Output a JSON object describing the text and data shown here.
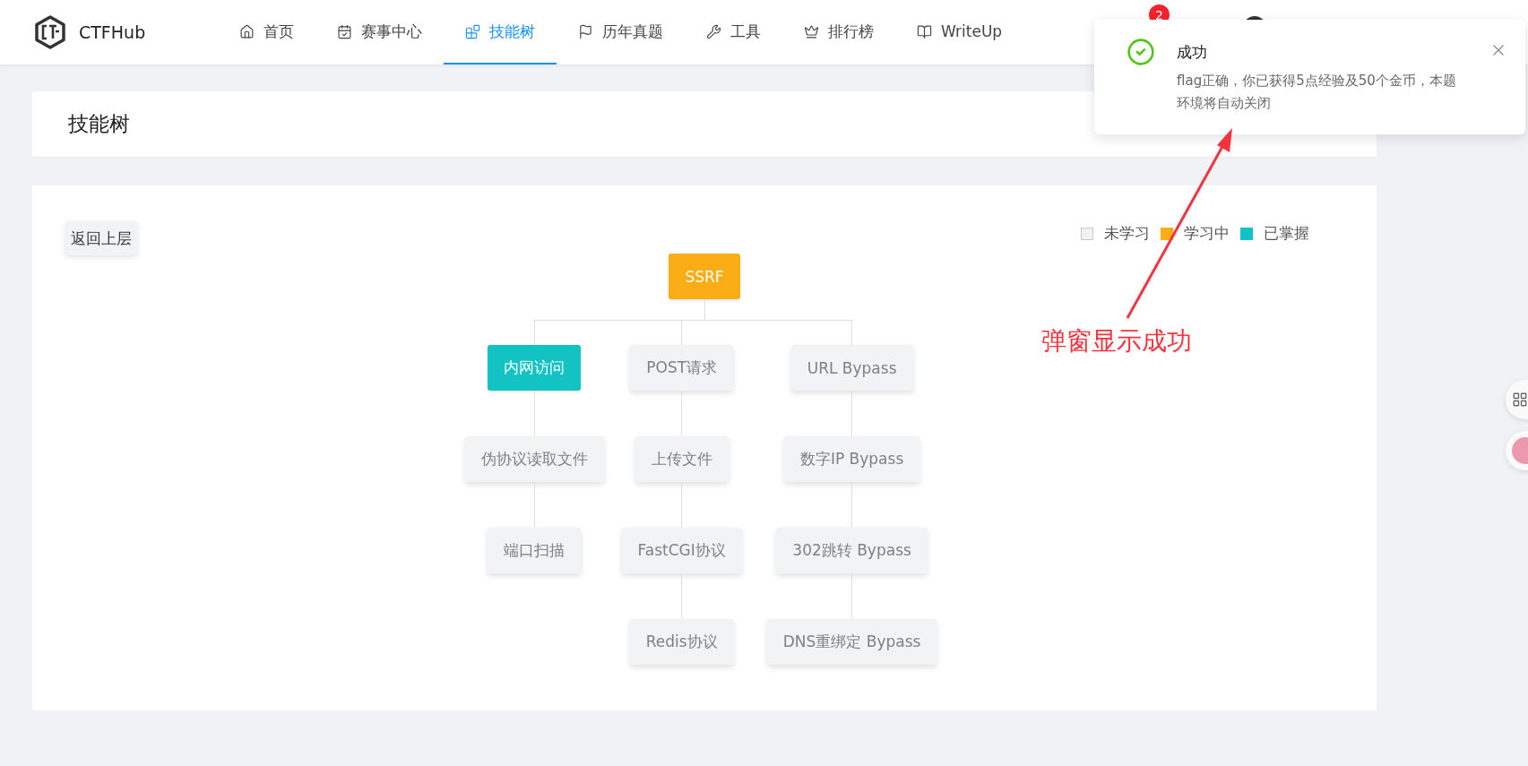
{
  "header": {
    "logo_text": "CTFHub",
    "badge": "2",
    "nav": [
      {
        "label": "首页",
        "selected": false
      },
      {
        "label": "赛事中心",
        "selected": false
      },
      {
        "label": "技能树",
        "selected": true
      },
      {
        "label": "历年真题",
        "selected": false
      },
      {
        "label": "工具",
        "selected": false
      },
      {
        "label": "排行榜",
        "selected": false
      },
      {
        "label": "WriteUp",
        "selected": false
      }
    ]
  },
  "page_title": "技能树",
  "back_button": "返回上层",
  "legend": [
    {
      "label": "未学习",
      "color": "#f0f2f5"
    },
    {
      "label": "学习中",
      "color": "#faad14"
    },
    {
      "label": "已掌握",
      "color": "#13c2c2"
    }
  ],
  "skill_tree": {
    "root": {
      "label": "SSRF",
      "kind": "learning",
      "children": [
        {
          "label": "内网访问",
          "kind": "mastered",
          "children": [
            {
              "label": "伪协议读取文件",
              "kind": "unlearned",
              "children": [
                {
                  "label": "端口扫描",
                  "kind": "unlearned"
                }
              ]
            }
          ]
        },
        {
          "label": "POST请求",
          "kind": "unlearned",
          "children": [
            {
              "label": "上传文件",
              "kind": "unlearned",
              "children": [
                {
                  "label": "FastCGI协议",
                  "kind": "unlearned",
                  "children": [
                    {
                      "label": "Redis协议",
                      "kind": "unlearned"
                    }
                  ]
                }
              ]
            }
          ]
        },
        {
          "label": "URL Bypass",
          "kind": "unlearned",
          "children": [
            {
              "label": "数字IP Bypass",
              "kind": "unlearned",
              "children": [
                {
                  "label": "302跳转 Bypass",
                  "kind": "unlearned",
                  "children": [
                    {
                      "label": "DNS重绑定 Bypass",
                      "kind": "unlearned"
                    }
                  ]
                }
              ]
            }
          ]
        }
      ]
    }
  },
  "notification": {
    "title": "成功",
    "message": "flag正确，你已获得5点经验及50个金币，本题环境将自动关闭"
  },
  "annotation": {
    "text": "弹窗显示成功"
  }
}
